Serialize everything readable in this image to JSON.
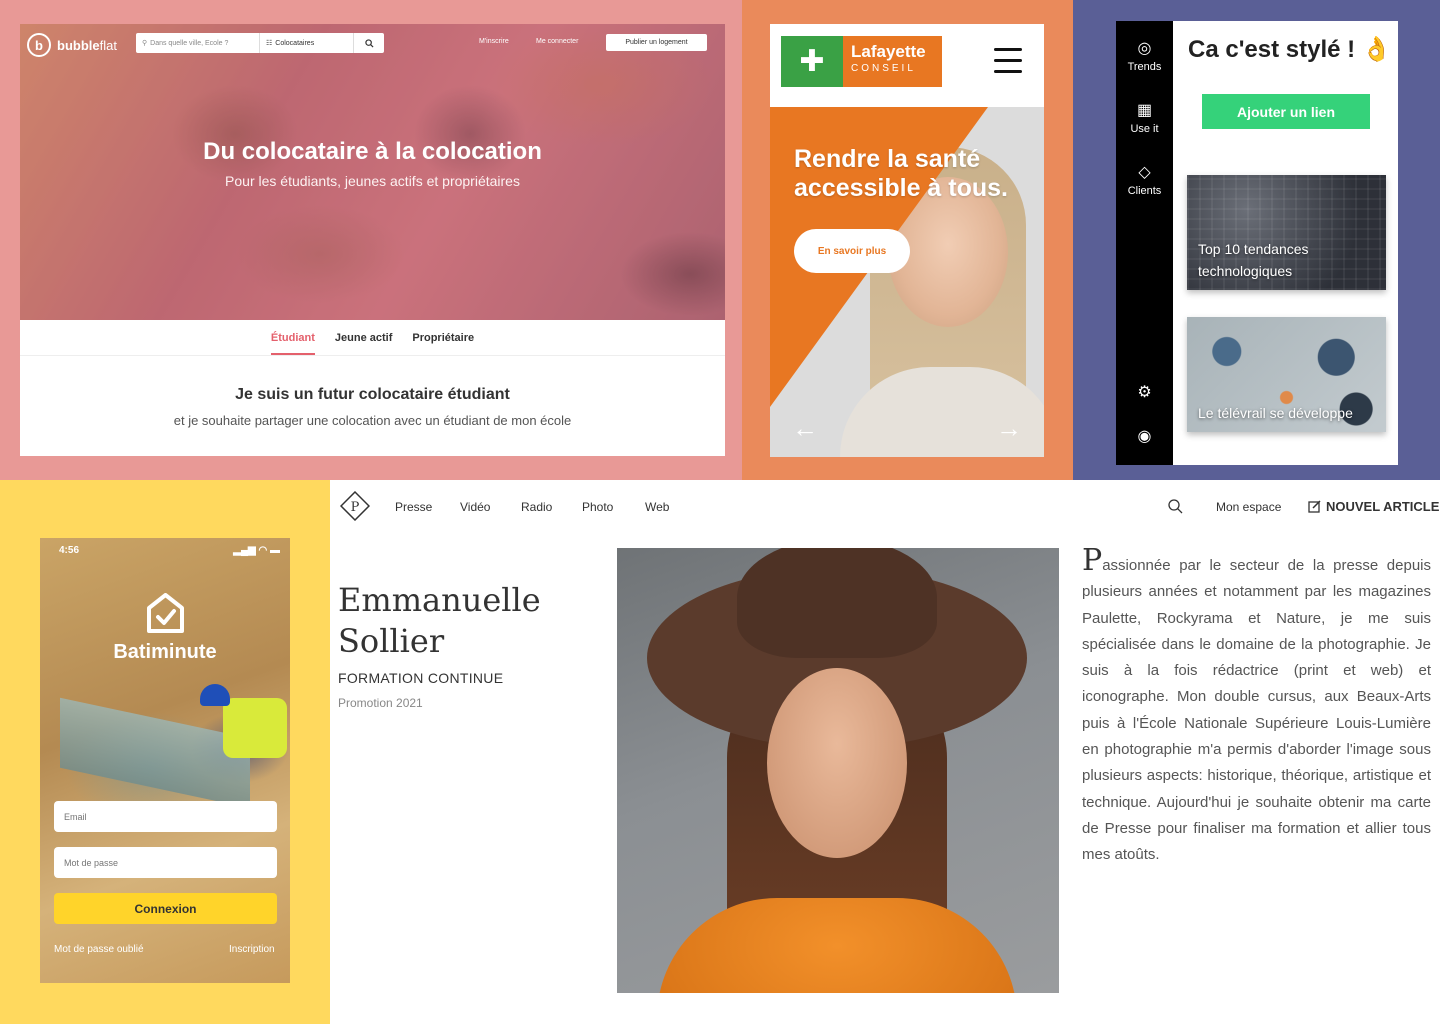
{
  "colors": {
    "pink_bg": "#e89996",
    "orange_bg": "#ea8a5b",
    "purple_bg": "#5a5f96",
    "yellow_bg": "#ffd95e",
    "bubbleflat_accent": "#e4606c",
    "lafayette_orange": "#e87722",
    "lafayette_green": "#3aa145",
    "trends_green": "#35d27a",
    "batiminute_yellow": "#ffd42a"
  },
  "bubbleflat": {
    "logo_bold": "bubble",
    "logo_light": "flat",
    "search_placeholder": "Dans quelle ville, Ecole ?",
    "search_type": "Colocataires",
    "nav_signup": "M'inscrire",
    "nav_login": "Me connecter",
    "publish_button": "Publier un logement",
    "hero_title": "Du colocataire à la colocation",
    "hero_subtitle": "Pour les étudiants, jeunes actifs et propriétaires",
    "tabs": [
      {
        "label": "Étudiant",
        "active": true
      },
      {
        "label": "Jeune actif",
        "active": false
      },
      {
        "label": "Propriétaire",
        "active": false
      }
    ],
    "heading": "Je suis un futur colocataire étudiant",
    "text": "et je souhaite partager une colocation avec un étudiant de mon école"
  },
  "lafayette": {
    "logo_line1": "Lafayette",
    "logo_line2": "CONSEIL",
    "hero_title": "Rendre la santé accessible à tous.",
    "cta": "En savoir plus",
    "prev_icon": "←",
    "next_icon": "→"
  },
  "trends": {
    "sidebar": [
      {
        "label": "Trends",
        "icon": "trends-icon"
      },
      {
        "label": "Use it",
        "icon": "use-it-icon"
      },
      {
        "label": "Clients",
        "icon": "diamond-icon"
      }
    ],
    "title": "Ca c'est stylé ! 👌",
    "add_button": "Ajouter un lien",
    "cards": [
      {
        "caption": "Top 10 tendances technologiques"
      },
      {
        "caption": "Le télévrail se développe"
      }
    ]
  },
  "batiminute": {
    "time": "4:56",
    "brand": "Batiminute",
    "email_placeholder": "Email",
    "password_placeholder": "Mot de passe",
    "login_button": "Connexion",
    "forgot_link": "Mot de passe oublié",
    "signup_link": "Inscription"
  },
  "portfolio": {
    "logo_letter": "P",
    "nav": [
      "Presse",
      "Vidéo",
      "Radio",
      "Photo",
      "Web"
    ],
    "my_space": "Mon espace",
    "new_article": "NOUVEL ARTICLE",
    "first_name": "Emmanuelle",
    "last_name": "Sollier",
    "role": "FORMATION CONTINUE",
    "promotion": "Promotion 2021",
    "bio_initial": "P",
    "bio_rest": "assionnée par le secteur de la presse depuis plusieurs années et notamment par les magazines Paulette, Rockyrama et Nature, je me suis spécialisée dans le domaine de la photographie. Je suis à la fois rédactrice (print et web) et iconographe. Mon double cursus, aux Beaux-Arts puis à l'École Nationale Supérieure Louis-Lumière en photographie m'a permis d'aborder l'image sous plusieurs aspects: historique, théorique, artistique et technique. Aujourd'hui je souhaite obtenir ma carte de Presse pour finaliser ma formation et allier tous mes atoûts."
  }
}
